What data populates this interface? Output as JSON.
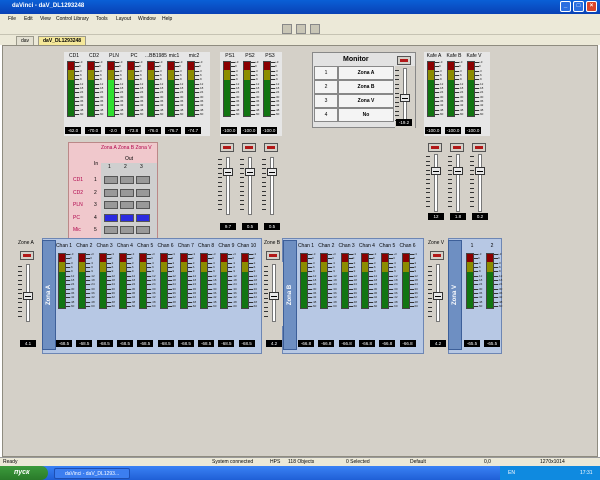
{
  "window": {
    "title": "daVinci - daV_DL1293248",
    "controls": [
      "_",
      "□",
      "×"
    ]
  },
  "menu": [
    "File",
    "Edit",
    "View",
    "Control Library",
    "Tools",
    "Layout",
    "Window",
    "Help"
  ],
  "tabs": [
    {
      "label": "dav"
    },
    {
      "label": "daV_DL1293248"
    }
  ],
  "strip1": {
    "channels": [
      {
        "label": "CD1",
        "value": "-62.0"
      },
      {
        "label": "CD2",
        "value": "-70.0"
      },
      {
        "label": "PLN",
        "value": "-2.0"
      },
      {
        "label": "PC",
        "value": "-73.8"
      },
      {
        "label": "...BB1985",
        "value": "-76.0"
      },
      {
        "label": "mic1",
        "value": "-76.7"
      },
      {
        "label": "mic2",
        "value": "-74.7"
      }
    ]
  },
  "strip2": {
    "channels": [
      {
        "label": "PS1",
        "value": "-100.0"
      },
      {
        "label": "PS2",
        "value": "-100.0"
      },
      {
        "label": "PS3",
        "value": "-100.0"
      }
    ]
  },
  "monitor": {
    "title": "Monitor",
    "rows": [
      {
        "num": "1",
        "name": "Zona A"
      },
      {
        "num": "2",
        "name": "Zona B"
      },
      {
        "num": "3",
        "name": "Zona V"
      },
      {
        "num": "4",
        "name": "No"
      }
    ],
    "value": "-19.2"
  },
  "kafe": {
    "channels": [
      {
        "label": "Kafe A",
        "value": "-100.0",
        "fader": "12"
      },
      {
        "label": "Kafe B",
        "value": "-100.0",
        "fader": "1.8"
      },
      {
        "label": "Kafe V",
        "value": "-100.0",
        "fader": "0.2"
      }
    ]
  },
  "matrix": {
    "header": "Zona A Zona B Zona V",
    "in_label": "In",
    "out_label": "Out",
    "cols": [
      "1",
      "2",
      "3"
    ],
    "rows": [
      {
        "name": "CD1",
        "num": "1"
      },
      {
        "name": "CD2",
        "num": "2"
      },
      {
        "name": "PLN",
        "num": "3"
      },
      {
        "name": "PC",
        "num": "4"
      },
      {
        "name": "Mic",
        "num": "5"
      }
    ]
  },
  "ps_faders": [
    "9.7",
    "0.5",
    "0.5"
  ],
  "scale_ticks": [
    "+3",
    "0",
    "-3",
    "-6",
    "-9",
    "-12",
    "-18",
    "-24",
    "-30",
    "-36",
    "-42",
    "-48",
    "-60"
  ],
  "zoneA": {
    "label": "Zone A",
    "bar": "Zona A",
    "fader": "4.1",
    "channels": [
      {
        "label": "Chan 1",
        "value": "-68.5"
      },
      {
        "label": "Chan 2",
        "value": "-68.5"
      },
      {
        "label": "Chan 3",
        "value": "-68.5"
      },
      {
        "label": "Chan 4",
        "value": "-68.5"
      },
      {
        "label": "Chan 5",
        "value": "-68.5"
      },
      {
        "label": "Chan 6",
        "value": "-68.5"
      },
      {
        "label": "Chan 7",
        "value": "-68.5"
      },
      {
        "label": "Chan 8",
        "value": "-68.5"
      },
      {
        "label": "Chan 9",
        "value": "-68.5"
      },
      {
        "label": "Chan 10",
        "value": "-68.5"
      }
    ]
  },
  "zoneB": {
    "label": "Zone B",
    "bar": "Zona B",
    "fader": "4.2",
    "channels": [
      {
        "label": "Chan 1",
        "value": "-66.8"
      },
      {
        "label": "Chan 2",
        "value": "-66.8"
      },
      {
        "label": "Chan 3",
        "value": "-66.8"
      },
      {
        "label": "Chan 4",
        "value": "-66.8"
      },
      {
        "label": "Chan 5",
        "value": "-66.8"
      },
      {
        "label": "Chan 6",
        "value": "-66.8"
      }
    ]
  },
  "zoneV": {
    "label": "Zone V",
    "bar": "Zona V",
    "fader": "4.2",
    "channels": [
      {
        "label": "1",
        "value": "-65.5"
      },
      {
        "label": "2",
        "value": "-65.5"
      }
    ]
  },
  "status": {
    "ready": "Ready",
    "connection": "System connected",
    "hps": "HPS",
    "objects": "118 Objects",
    "selected": "0 Selected",
    "mode": "Default",
    "coords": "0,0",
    "resolution": "1270x1014"
  },
  "taskbar": {
    "start": "пуск",
    "task": "daVinci - daV_DL1293...",
    "lang": "EN",
    "time": "17:31"
  },
  "colors": {
    "titlebar": "#0a5fd6",
    "workspace": "#d4d0c8",
    "meter_green": "#127512",
    "meter_red": "#8b0000",
    "matrix_on": "#2a2ae0",
    "zone_bar": "#6e8fc2"
  }
}
